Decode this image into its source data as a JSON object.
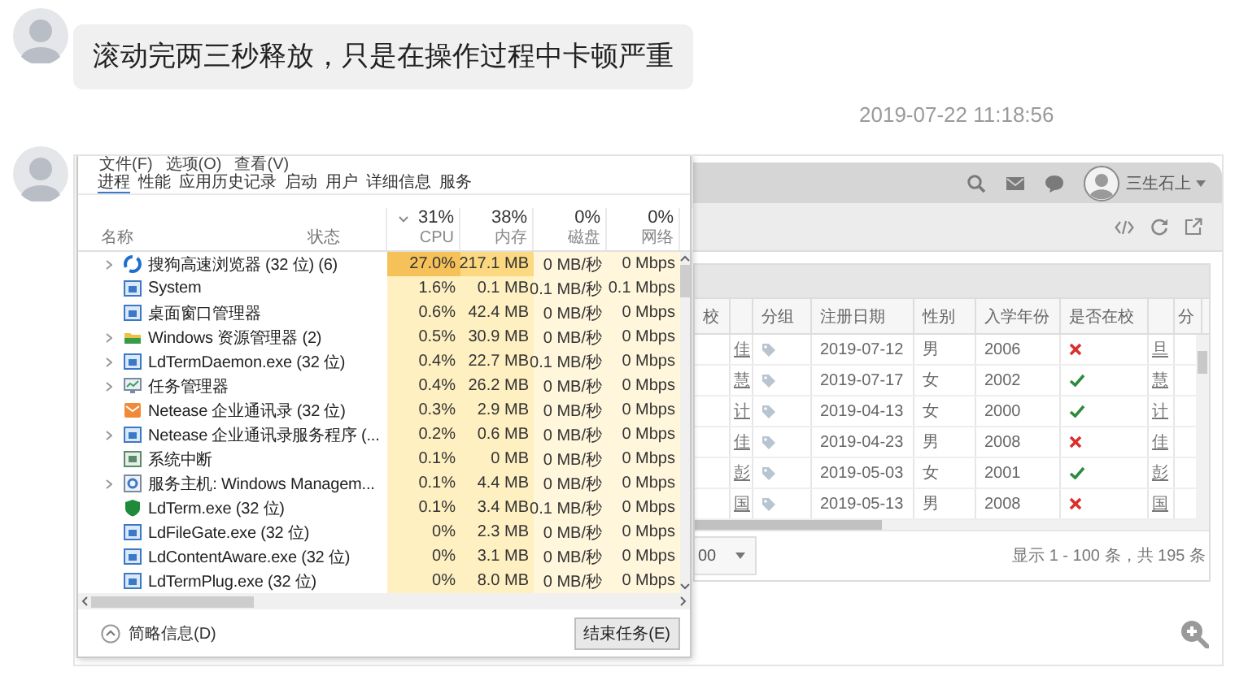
{
  "conversation": {
    "message": {
      "text": "滚动完两三秒释放，只是在操作过程中卡顿严重"
    },
    "timestamp": "2019-07-22 11:18:56",
    "image": {
      "web_app": {
        "user_name": "三生石上",
        "table": {
          "columns": [
            {
              "label": "校"
            },
            {
              "label": "分组"
            },
            {
              "label": "注册日期"
            },
            {
              "label": "性别"
            },
            {
              "label": "入学年份"
            },
            {
              "label": "是否在校"
            },
            {
              "label": "分"
            }
          ],
          "rows": [
            {
              "lead": "佳",
              "date": "2019-07-12",
              "gender": "男",
              "year": "2006",
              "in_school": false,
              "trail": "旦"
            },
            {
              "lead": "慧",
              "date": "2019-07-17",
              "gender": "女",
              "year": "2002",
              "in_school": true,
              "trail": "慧"
            },
            {
              "lead": "计",
              "date": "2019-04-13",
              "gender": "女",
              "year": "2000",
              "in_school": true,
              "trail": "计"
            },
            {
              "lead": "佳",
              "date": "2019-04-23",
              "gender": "男",
              "year": "2008",
              "in_school": false,
              "trail": "佳"
            },
            {
              "lead": "彭",
              "date": "2019-05-03",
              "gender": "女",
              "year": "2001",
              "in_school": true,
              "trail": "彭"
            },
            {
              "lead": "国",
              "date": "2019-05-13",
              "gender": "男",
              "year": "2008",
              "in_school": false,
              "trail": "国"
            }
          ],
          "page_size": "00",
          "summary": "显示 1 - 100 条，共 195 条"
        }
      },
      "task_manager": {
        "menu": [
          "文件(F)",
          "选项(O)",
          "查看(V)"
        ],
        "tabs": [
          {
            "label": "进程",
            "selected": true
          },
          {
            "label": "性能",
            "selected": false
          },
          {
            "label": "应用历史记录",
            "selected": false
          },
          {
            "label": "启动",
            "selected": false
          },
          {
            "label": "用户",
            "selected": false
          },
          {
            "label": "详细信息",
            "selected": false
          },
          {
            "label": "服务",
            "selected": false
          }
        ],
        "columns": [
          {
            "label": "名称",
            "sorted": false
          },
          {
            "label": "状态",
            "sorted": false
          },
          {
            "label": "CPU",
            "total": "31%",
            "sorted": true
          },
          {
            "label": "内存",
            "total": "38%",
            "sorted": false
          },
          {
            "label": "磁盘",
            "total": "0%",
            "sorted": false
          },
          {
            "label": "网络",
            "total": "0%",
            "sorted": false
          }
        ],
        "processes": [
          {
            "name": "搜狗高速浏览器 (32 位) (6)",
            "kind": "globe",
            "expandable": true,
            "hot": true,
            "cpu": "27.0%",
            "memory": "217.1 MB",
            "disk": "0 MB/秒",
            "network": "0 Mbps"
          },
          {
            "name": "System",
            "kind": "window",
            "expandable": false,
            "hot": false,
            "cpu": "1.6%",
            "memory": "0.1 MB",
            "disk": "0.1 MB/秒",
            "network": "0.1 Mbps"
          },
          {
            "name": "桌面窗口管理器",
            "kind": "window",
            "expandable": false,
            "hot": false,
            "cpu": "0.6%",
            "memory": "42.4 MB",
            "disk": "0 MB/秒",
            "network": "0 Mbps"
          },
          {
            "name": "Windows 资源管理器 (2)",
            "kind": "folder",
            "expandable": true,
            "hot": false,
            "cpu": "0.5%",
            "memory": "30.9 MB",
            "disk": "0 MB/秒",
            "network": "0 Mbps"
          },
          {
            "name": "LdTermDaemon.exe (32 位)",
            "kind": "window",
            "expandable": true,
            "hot": false,
            "cpu": "0.4%",
            "memory": "22.7 MB",
            "disk": "0.1 MB/秒",
            "network": "0 Mbps"
          },
          {
            "name": "任务管理器",
            "kind": "monitor",
            "expandable": true,
            "hot": false,
            "cpu": "0.4%",
            "memory": "26.2 MB",
            "disk": "0 MB/秒",
            "network": "0 Mbps"
          },
          {
            "name": "Netease 企业通讯录 (32 位)",
            "kind": "envelope",
            "expandable": false,
            "hot": false,
            "cpu": "0.3%",
            "memory": "2.9 MB",
            "disk": "0 MB/秒",
            "network": "0 Mbps"
          },
          {
            "name": "Netease 企业通讯录服务程序 (...",
            "kind": "window",
            "expandable": true,
            "hot": false,
            "cpu": "0.2%",
            "memory": "0.6 MB",
            "disk": "0 MB/秒",
            "network": "0 Mbps"
          },
          {
            "name": "系统中断",
            "kind": "chip",
            "expandable": false,
            "hot": false,
            "cpu": "0.1%",
            "memory": "0 MB",
            "disk": "0 MB/秒",
            "network": "0 Mbps"
          },
          {
            "name": "服务主机: Windows Managem...",
            "kind": "gear",
            "expandable": true,
            "hot": false,
            "cpu": "0.1%",
            "memory": "4.4 MB",
            "disk": "0 MB/秒",
            "network": "0 Mbps"
          },
          {
            "name": "LdTerm.exe (32 位)",
            "kind": "shield",
            "expandable": false,
            "hot": false,
            "cpu": "0.1%",
            "memory": "3.4 MB",
            "disk": "0.1 MB/秒",
            "network": "0 Mbps"
          },
          {
            "name": "LdFileGate.exe (32 位)",
            "kind": "window",
            "expandable": false,
            "hot": false,
            "cpu": "0%",
            "memory": "2.3 MB",
            "disk": "0 MB/秒",
            "network": "0 Mbps"
          },
          {
            "name": "LdContentAware.exe (32 位)",
            "kind": "window",
            "expandable": false,
            "hot": false,
            "cpu": "0%",
            "memory": "3.1 MB",
            "disk": "0 MB/秒",
            "network": "0 Mbps"
          },
          {
            "name": "LdTermPlug.exe (32 位)",
            "kind": "window",
            "expandable": false,
            "hot": false,
            "cpu": "0%",
            "memory": "8.0 MB",
            "disk": "0 MB/秒",
            "network": "0 Mbps"
          }
        ],
        "details_link": "简略信息(D)",
        "end_task_button": "结束任务(E)"
      }
    }
  }
}
